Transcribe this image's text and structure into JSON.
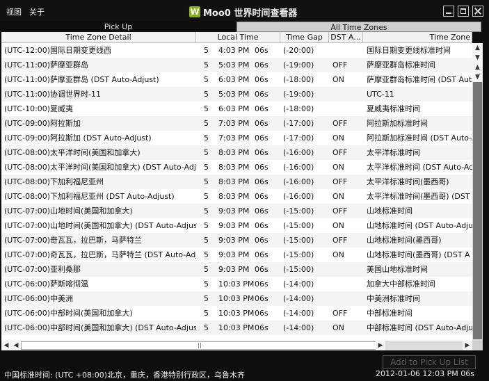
{
  "menu": {
    "view": "视图",
    "about": "关于"
  },
  "app": {
    "logo": "W",
    "title": "Moo0 世界时间查看器"
  },
  "tabs": {
    "pick_up": "Pick Up",
    "all_time_zones": "All Time Zones"
  },
  "columns": {
    "time_zone_detail": "Time Zone Detail",
    "local_time": "Local Time",
    "time_gap": "Time Gap",
    "dst": "DST A...",
    "time_zone": "Time Zone"
  },
  "rows": [
    {
      "detail": "(UTC-12:00)国际日期变更线西",
      "day": "5",
      "time": "4:03 PM",
      "sec": "06s",
      "gap": "(-20:00)",
      "dst": "",
      "zone": "国际日期变更线标准时间"
    },
    {
      "detail": "(UTC-11:00)萨摩亚群岛",
      "day": "5",
      "time": "5:03 PM",
      "sec": "06s",
      "gap": "(-19:00)",
      "dst": "OFF",
      "zone": "萨摩亚群岛标准时间"
    },
    {
      "detail": "(UTC-11:00)萨摩亚群岛 (DST Auto-Adjust)",
      "day": "5",
      "time": "6:03 PM",
      "sec": "06s",
      "gap": "(-18:00)",
      "dst": "ON",
      "zone": "萨摩亚群岛标准时间 (DST Auto"
    },
    {
      "detail": "(UTC-11:00)协调世界时-11",
      "day": "5",
      "time": "5:03 PM",
      "sec": "06s",
      "gap": "(-19:00)",
      "dst": "",
      "zone": "UTC-11"
    },
    {
      "detail": "(UTC-10:00)夏威夷",
      "day": "5",
      "time": "6:03 PM",
      "sec": "06s",
      "gap": "(-18:00)",
      "dst": "",
      "zone": "夏威夷标准时间"
    },
    {
      "detail": "(UTC-09:00)阿拉斯加",
      "day": "5",
      "time": "7:03 PM",
      "sec": "06s",
      "gap": "(-17:00)",
      "dst": "OFF",
      "zone": "阿拉斯加标准时间"
    },
    {
      "detail": "(UTC-09:00)阿拉斯加 (DST Auto-Adjust)",
      "day": "5",
      "time": "7:03 PM",
      "sec": "06s",
      "gap": "(-17:00)",
      "dst": "ON",
      "zone": "阿拉斯加标准时间 (DST Auto-A"
    },
    {
      "detail": "(UTC-08:00)太平洋时间(美国和加拿大)",
      "day": "5",
      "time": "8:03 PM",
      "sec": "06s",
      "gap": "(-16:00)",
      "dst": "OFF",
      "zone": "太平洋标准时间"
    },
    {
      "detail": "(UTC-08:00)太平洋时间(美国和加拿大) (DST Auto-Adju",
      "day": "5",
      "time": "8:03 PM",
      "sec": "06s",
      "gap": "(-16:00)",
      "dst": "ON",
      "zone": "太平洋标准时间 (DST Auto-Ad"
    },
    {
      "detail": "(UTC-08:00)下加利福尼亚州",
      "day": "5",
      "time": "8:03 PM",
      "sec": "06s",
      "gap": "(-16:00)",
      "dst": "OFF",
      "zone": "太平洋标准时间(墨西哥)"
    },
    {
      "detail": "(UTC-08:00)下加利福尼亚州 (DST Auto-Adjust)",
      "day": "5",
      "time": "8:03 PM",
      "sec": "06s",
      "gap": "(-16:00)",
      "dst": "ON",
      "zone": "太平洋标准时间(墨西哥) (DST A"
    },
    {
      "detail": "(UTC-07:00)山地时间(美国和加拿大)",
      "day": "5",
      "time": "9:03 PM",
      "sec": "06s",
      "gap": "(-15:00)",
      "dst": "OFF",
      "zone": "山地标准时间"
    },
    {
      "detail": "(UTC-07:00)山地时间(美国和加拿大) (DST Auto-Adjust)",
      "day": "5",
      "time": "9:03 PM",
      "sec": "06s",
      "gap": "(-15:00)",
      "dst": "ON",
      "zone": "山地标准时间 (DST Auto-Adju"
    },
    {
      "detail": "(UTC-07:00)奇瓦瓦，拉巴斯，马萨特兰",
      "day": "5",
      "time": "9:03 PM",
      "sec": "06s",
      "gap": "(-15:00)",
      "dst": "OFF",
      "zone": "山地标准时间(墨西哥)"
    },
    {
      "detail": "(UTC-07:00)奇瓦瓦，拉巴斯，马萨特兰 (DST Auto-Adju",
      "day": "5",
      "time": "9:03 PM",
      "sec": "06s",
      "gap": "(-15:00)",
      "dst": "ON",
      "zone": "山地标准时间(墨西哥) (DST A"
    },
    {
      "detail": "(UTC-07:00)亚利桑那",
      "day": "5",
      "time": "9:03 PM",
      "sec": "06s",
      "gap": "(-15:00)",
      "dst": "",
      "zone": "美国山地标准时间"
    },
    {
      "detail": "(UTC-06:00)萨斯喀彻温",
      "day": "5",
      "time": "10:03 PM",
      "sec": "06s",
      "gap": "(-14:00)",
      "dst": "",
      "zone": "加拿大中部标准时间"
    },
    {
      "detail": "(UTC-06:00)中美洲",
      "day": "5",
      "time": "10:03 PM",
      "sec": "06s",
      "gap": "(-14:00)",
      "dst": "",
      "zone": "中美洲标准时间"
    },
    {
      "detail": "(UTC-06:00)中部时间(美国和加拿大)",
      "day": "5",
      "time": "10:03 PM",
      "sec": "06s",
      "gap": "(-14:00)",
      "dst": "OFF",
      "zone": "中部标准时间"
    },
    {
      "detail": "(UTC-06:00)中部时间(美国和加拿大) (DST Auto-Adjust)",
      "day": "5",
      "time": "10:03 PM",
      "sec": "06s",
      "gap": "(-14:00)",
      "dst": "ON",
      "zone": "中部标准时间 (DST Auto-Adju"
    }
  ],
  "buttons": {
    "add_to_pick_up": "Add to Pick Up List"
  },
  "status": {
    "local_zone": "中国标准时间: (UTC +08:00)北京，重庆，香港特别行政区，乌鲁木齐",
    "datetime": "2012-01-06  12:03 PM  06s"
  },
  "icons": {
    "scroll_up": "scroll-up-arrow-icon",
    "scroll_down": "scroll-down-arrow-icon",
    "scroll_left": "scroll-left-arrow-icon",
    "scroll_right": "scroll-right-arrow-icon"
  },
  "colors": {
    "window_bg": "#0e0e0e",
    "logo_green": "#8ab020",
    "row_alt": "#f4f4f4"
  }
}
